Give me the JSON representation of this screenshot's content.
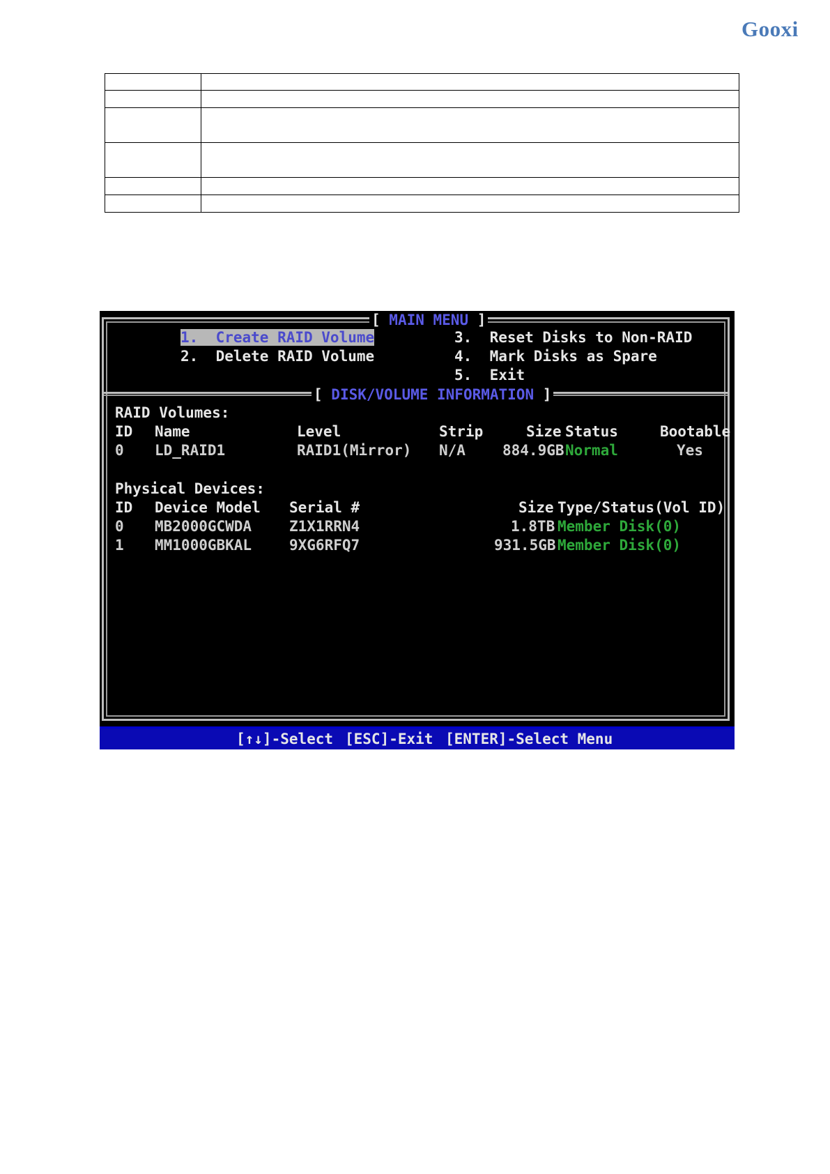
{
  "brand": {
    "logo_text": "Gooxi"
  },
  "bios": {
    "main_menu_title": "MAIN MENU",
    "menu": {
      "item1": "1.  Create RAID Volume",
      "item2": "2.  Delete RAID Volume",
      "item3": "3.  Reset Disks to Non-RAID",
      "item4": "4.  Mark Disks as Spare",
      "item5": "5.  Exit"
    },
    "info_title": "DISK/VOLUME INFORMATION",
    "raid_volumes": {
      "heading": "RAID Volumes:",
      "headers": {
        "id": "ID",
        "name": "Name",
        "level": "Level",
        "strip": "Strip",
        "size": "Size",
        "status": "Status",
        "bootable": "Bootable"
      },
      "row": {
        "id": "0",
        "name": "LD_RAID1",
        "level": "RAID1(Mirror)",
        "strip": "N/A",
        "size": "884.9GB",
        "status": "Normal",
        "bootable": "Yes"
      }
    },
    "physical_devices": {
      "heading": "Physical Devices:",
      "headers": {
        "id": "ID",
        "model": "Device Model",
        "serial": "Serial #",
        "size": "Size",
        "type": "Type/Status(Vol ID)"
      },
      "rows": [
        {
          "id": "0",
          "model": "MB2000GCWDA",
          "serial": "Z1X1RRN4",
          "size": "1.8TB",
          "type": "Member Disk(0)"
        },
        {
          "id": "1",
          "model": "MM1000GBKAL",
          "serial": "9XG6RFQ7",
          "size": "931.5GB",
          "type": "Member Disk(0)"
        }
      ]
    },
    "status_bar": {
      "select": "[↑↓]-Select",
      "exit": "[ESC]-Exit",
      "enter": "[ENTER]-Select Menu"
    }
  },
  "colors": {
    "screen_bg": "#000000",
    "status_bar_bg": "#0a0ab4",
    "ok_green": "#2ea83a",
    "title_blue": "#5a5ae6",
    "logo_blue": "#4a7ab8"
  }
}
